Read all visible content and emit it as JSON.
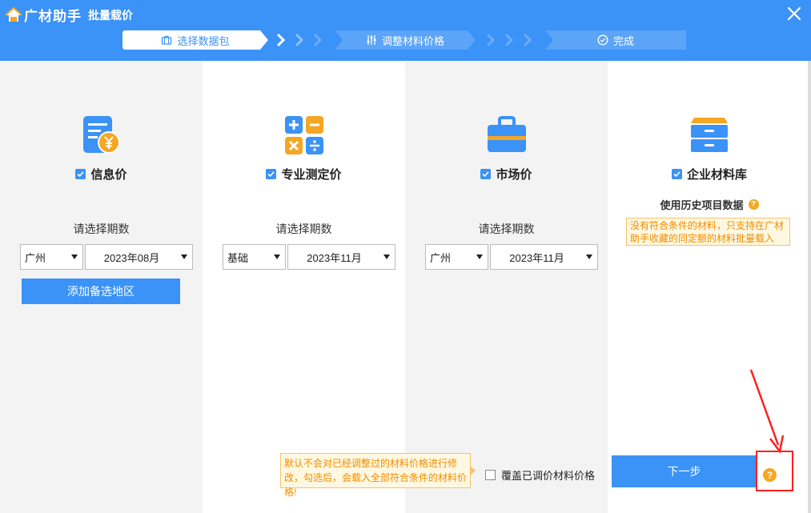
{
  "header": {
    "brand": "广材助手",
    "title": "批量载价"
  },
  "steps": [
    {
      "label": "选择数据包",
      "icon": "briefcase-icon",
      "active": true
    },
    {
      "label": "调整材料价格",
      "icon": "sliders-icon",
      "active": false
    },
    {
      "label": "完成",
      "icon": "check-circle-icon",
      "active": false
    }
  ],
  "columns": {
    "info": {
      "icon": "invoice-yen-icon",
      "option": "信息价",
      "checked": true,
      "period_label": "请选择期数",
      "region": "广州",
      "date": "2023年08月",
      "add_button": "添加备选地区"
    },
    "professional": {
      "icon": "calculator-icon",
      "option": "专业测定价",
      "checked": true,
      "period_label": "请选择期数",
      "type": "基础",
      "date": "2023年11月"
    },
    "market": {
      "icon": "toolbox-icon",
      "option": "市场价",
      "checked": true,
      "period_label": "请选择期数",
      "region": "广州",
      "date": "2023年11月"
    },
    "enterprise": {
      "icon": "cabinet-icon",
      "option": "企业材料库",
      "checked": true,
      "history_label": "使用历史项目数据",
      "notice": "没有符合条件的材料，只支持在广材助手收藏的同定额的材料批量载入"
    }
  },
  "footer": {
    "tooltip": "默认不会对已经调整过的材料价格进行修改，勾选后，会载入全部符合条件的材料价格!",
    "overwrite_label": "覆盖已调价材料价格",
    "overwrite_checked": false,
    "next_button": "下一步",
    "help_glyph": "?"
  },
  "colors": {
    "primary": "#3b92f7",
    "warning": "#f5a623",
    "highlight": "#ff2020"
  }
}
